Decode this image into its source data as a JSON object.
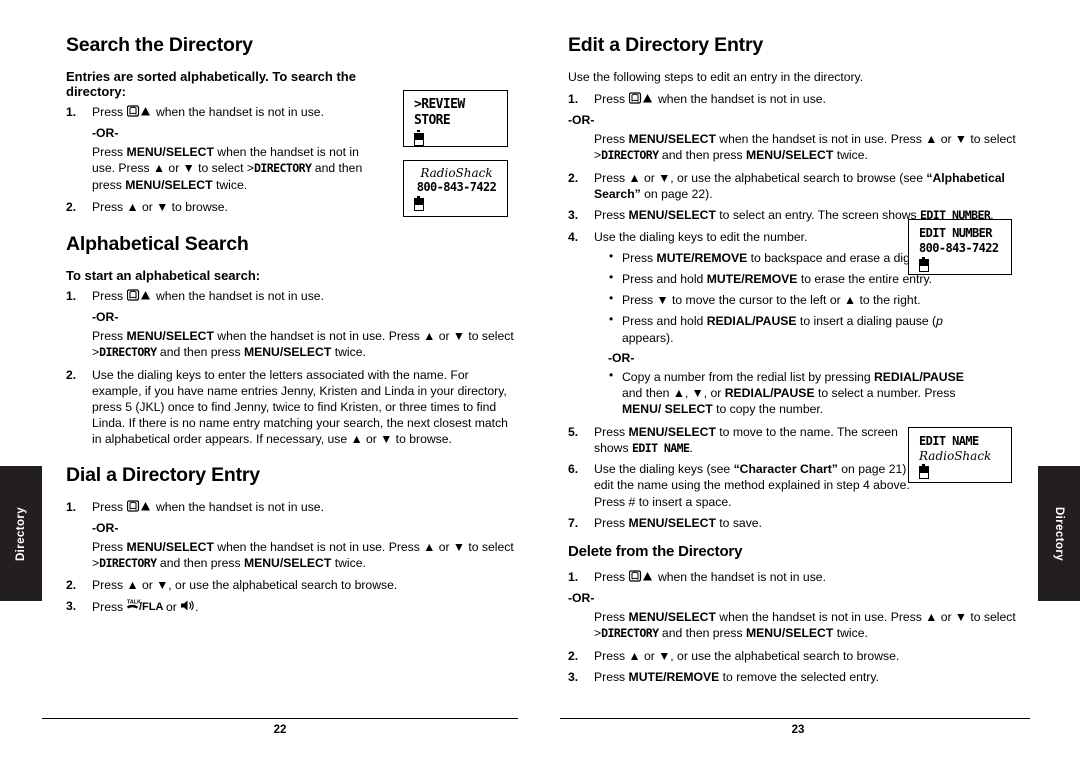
{
  "side_tabs": {
    "left_label": "Directory",
    "right_label": "Directory"
  },
  "left_page": {
    "number": "22",
    "sections": [
      {
        "id": "search-the-directory",
        "heading": "Search the Directory",
        "intro_bold": "Entries are sorted alphabetically. To search the directory:",
        "steps": [
          {
            "num": "1.",
            "text_before": "Press",
            "icon": "phonebook-up-icon",
            "text_after": "when the handset is not in use."
          },
          {
            "num": "2.",
            "text": "Press ▲ or ▼ to browse."
          }
        ],
        "or_label": "-OR-",
        "or_text_1": "Press ",
        "or_bold_1": "MENU/SELECT",
        "or_text_2": " when the handset is not in use. Press ▲ or ▼ to select >",
        "or_lcd": "DIRECTORY",
        "or_text_3": " and then press ",
        "or_bold_2": "MENU/SELECT",
        "or_text_4": " twice."
      },
      {
        "id": "alphabetical-search",
        "heading": "Alphabetical Search",
        "intro_bold": "To start an alphabetical search:",
        "steps": [
          {
            "num": "1.",
            "text_before": "Press",
            "icon": "phonebook-up-icon",
            "text_after": "when the handset is not in use."
          },
          {
            "num": "2.",
            "text": "Use the dialing keys to enter the letters associated with the name. For example, if you have name entries Jenny, Kristen and Linda in your directory, press 5 (JKL) once to find Jenny, twice to find Kristen, or three times to find Linda. If there is no name entry matching your search, the next closest match in alphabetical order appears. If necessary, use ▲ or ▼ to browse."
          }
        ],
        "or_label": "-OR-",
        "or_text_1": "Press ",
        "or_bold_1": "MENU/SELECT",
        "or_text_2": " when the handset is not in use. Press ▲ or ▼ to select >",
        "or_lcd": "DIRECTORY",
        "or_text_3": " and then press ",
        "or_bold_2": "MENU/SELECT",
        "or_text_4": " twice."
      },
      {
        "id": "dial-a-directory-entry",
        "heading": "Dial a Directory Entry",
        "steps": [
          {
            "num": "1.",
            "text_before": "Press",
            "icon": "phonebook-up-icon",
            "text_after": "when the handset is not in use."
          },
          {
            "num": "2.",
            "text": "Press ▲ or ▼, or use the alphabetical search to browse."
          },
          {
            "num": "3.",
            "text_before": "Press",
            "icon": "talk-flash-key",
            "text_after": "or",
            "icon2": "speakerphone-icon",
            "text_end": "."
          }
        ],
        "or_label": "-OR-",
        "or_text_1": "Press ",
        "or_bold_1": "MENU/SELECT",
        "or_text_2": " when the handset is not in use. Press ▲ or ▼ to select >",
        "or_lcd": "DIRECTORY",
        "or_text_3": " and then press ",
        "or_bold_2": "MENU/SELECT",
        "or_text_4": " twice."
      }
    ],
    "lcd_screens": [
      {
        "id": "review-store",
        "line1": ">REVIEW",
        "line2": " STORE",
        "battery": true
      },
      {
        "id": "radioshack-number",
        "line1": "RadioShack",
        "line2": "800-843-7422",
        "battery": true
      }
    ]
  },
  "right_page": {
    "number": "23",
    "sections": [
      {
        "id": "edit-a-directory-entry",
        "heading": "Edit a Directory Entry",
        "intro": "Use the following steps to edit an entry in the directory.",
        "steps": [
          {
            "num": "1.",
            "text_before": "Press",
            "icon": "phonebook-up-icon",
            "text_after": "when the handset is not in use."
          },
          {
            "num": "2.",
            "text": "Press ▲ or ▼, or use the alphabetical search to browse (see “Alphabetical Search” on page 22)."
          },
          {
            "num": "3.",
            "text": "Press MENU/SELECT to select an entry. The screen shows EDIT NUMBER."
          },
          {
            "num": "4.",
            "text": "Use the dialing keys to edit the number."
          },
          {
            "num": "5.",
            "text": "Press MENU/SELECT to move to the name. The screen shows EDIT NAME."
          },
          {
            "num": "6.",
            "text": "Use the dialing keys (see “Character Chart” on page 21) to edit the name using the method explained in step 4 above. Press # to insert a space."
          },
          {
            "num": "7.",
            "text": "Press MENU/SELECT to save."
          }
        ],
        "or_label": "-OR-",
        "bullets_step4": [
          "Press MUTE/REMOVE to backspace and erase a digit.",
          "Press and hold MUTE/REMOVE to erase the entire entry.",
          "Press ▼ to move the cursor to the left or ▲ to the right.",
          "Press and hold REDIAL/PAUSE to insert a dialing pause (p appears)."
        ],
        "bullets_after_or": [
          "Copy a number from the redial list by pressing REDIAL/PAUSE and then ▲, ▼, or REDIAL/PAUSE to select a number. Press MENU/SELECT to copy the number."
        ]
      },
      {
        "id": "delete-from-the-directory",
        "heading": "Delete from the Directory",
        "steps": [
          {
            "num": "1.",
            "text_before": "Press",
            "icon": "phonebook-up-icon",
            "text_after": "when the handset is not in use."
          },
          {
            "num": "2.",
            "text": "Press ▲ or ▼, or use the alphabetical search to browse."
          },
          {
            "num": "3.",
            "text": "Press MUTE/REMOVE to remove the selected entry."
          }
        ],
        "or_label": "-OR-",
        "or_text_1": "Press ",
        "or_bold_1": "MENU/SELECT",
        "or_text_2": " when the handset is not in use. Press ▲ or ▼ to select >",
        "or_lcd": "DIRECTORY",
        "or_text_3": " and then press ",
        "or_bold_2": "MENU/SELECT",
        "or_text_4": " twice."
      }
    ],
    "lcd_screens": [
      {
        "id": "edit-number",
        "line1": "EDIT NUMBER",
        "line2": "800-843-7422",
        "battery": true
      },
      {
        "id": "edit-name",
        "line1": "EDIT NAME",
        "line2": "RadioShack",
        "battery": true
      }
    ]
  }
}
